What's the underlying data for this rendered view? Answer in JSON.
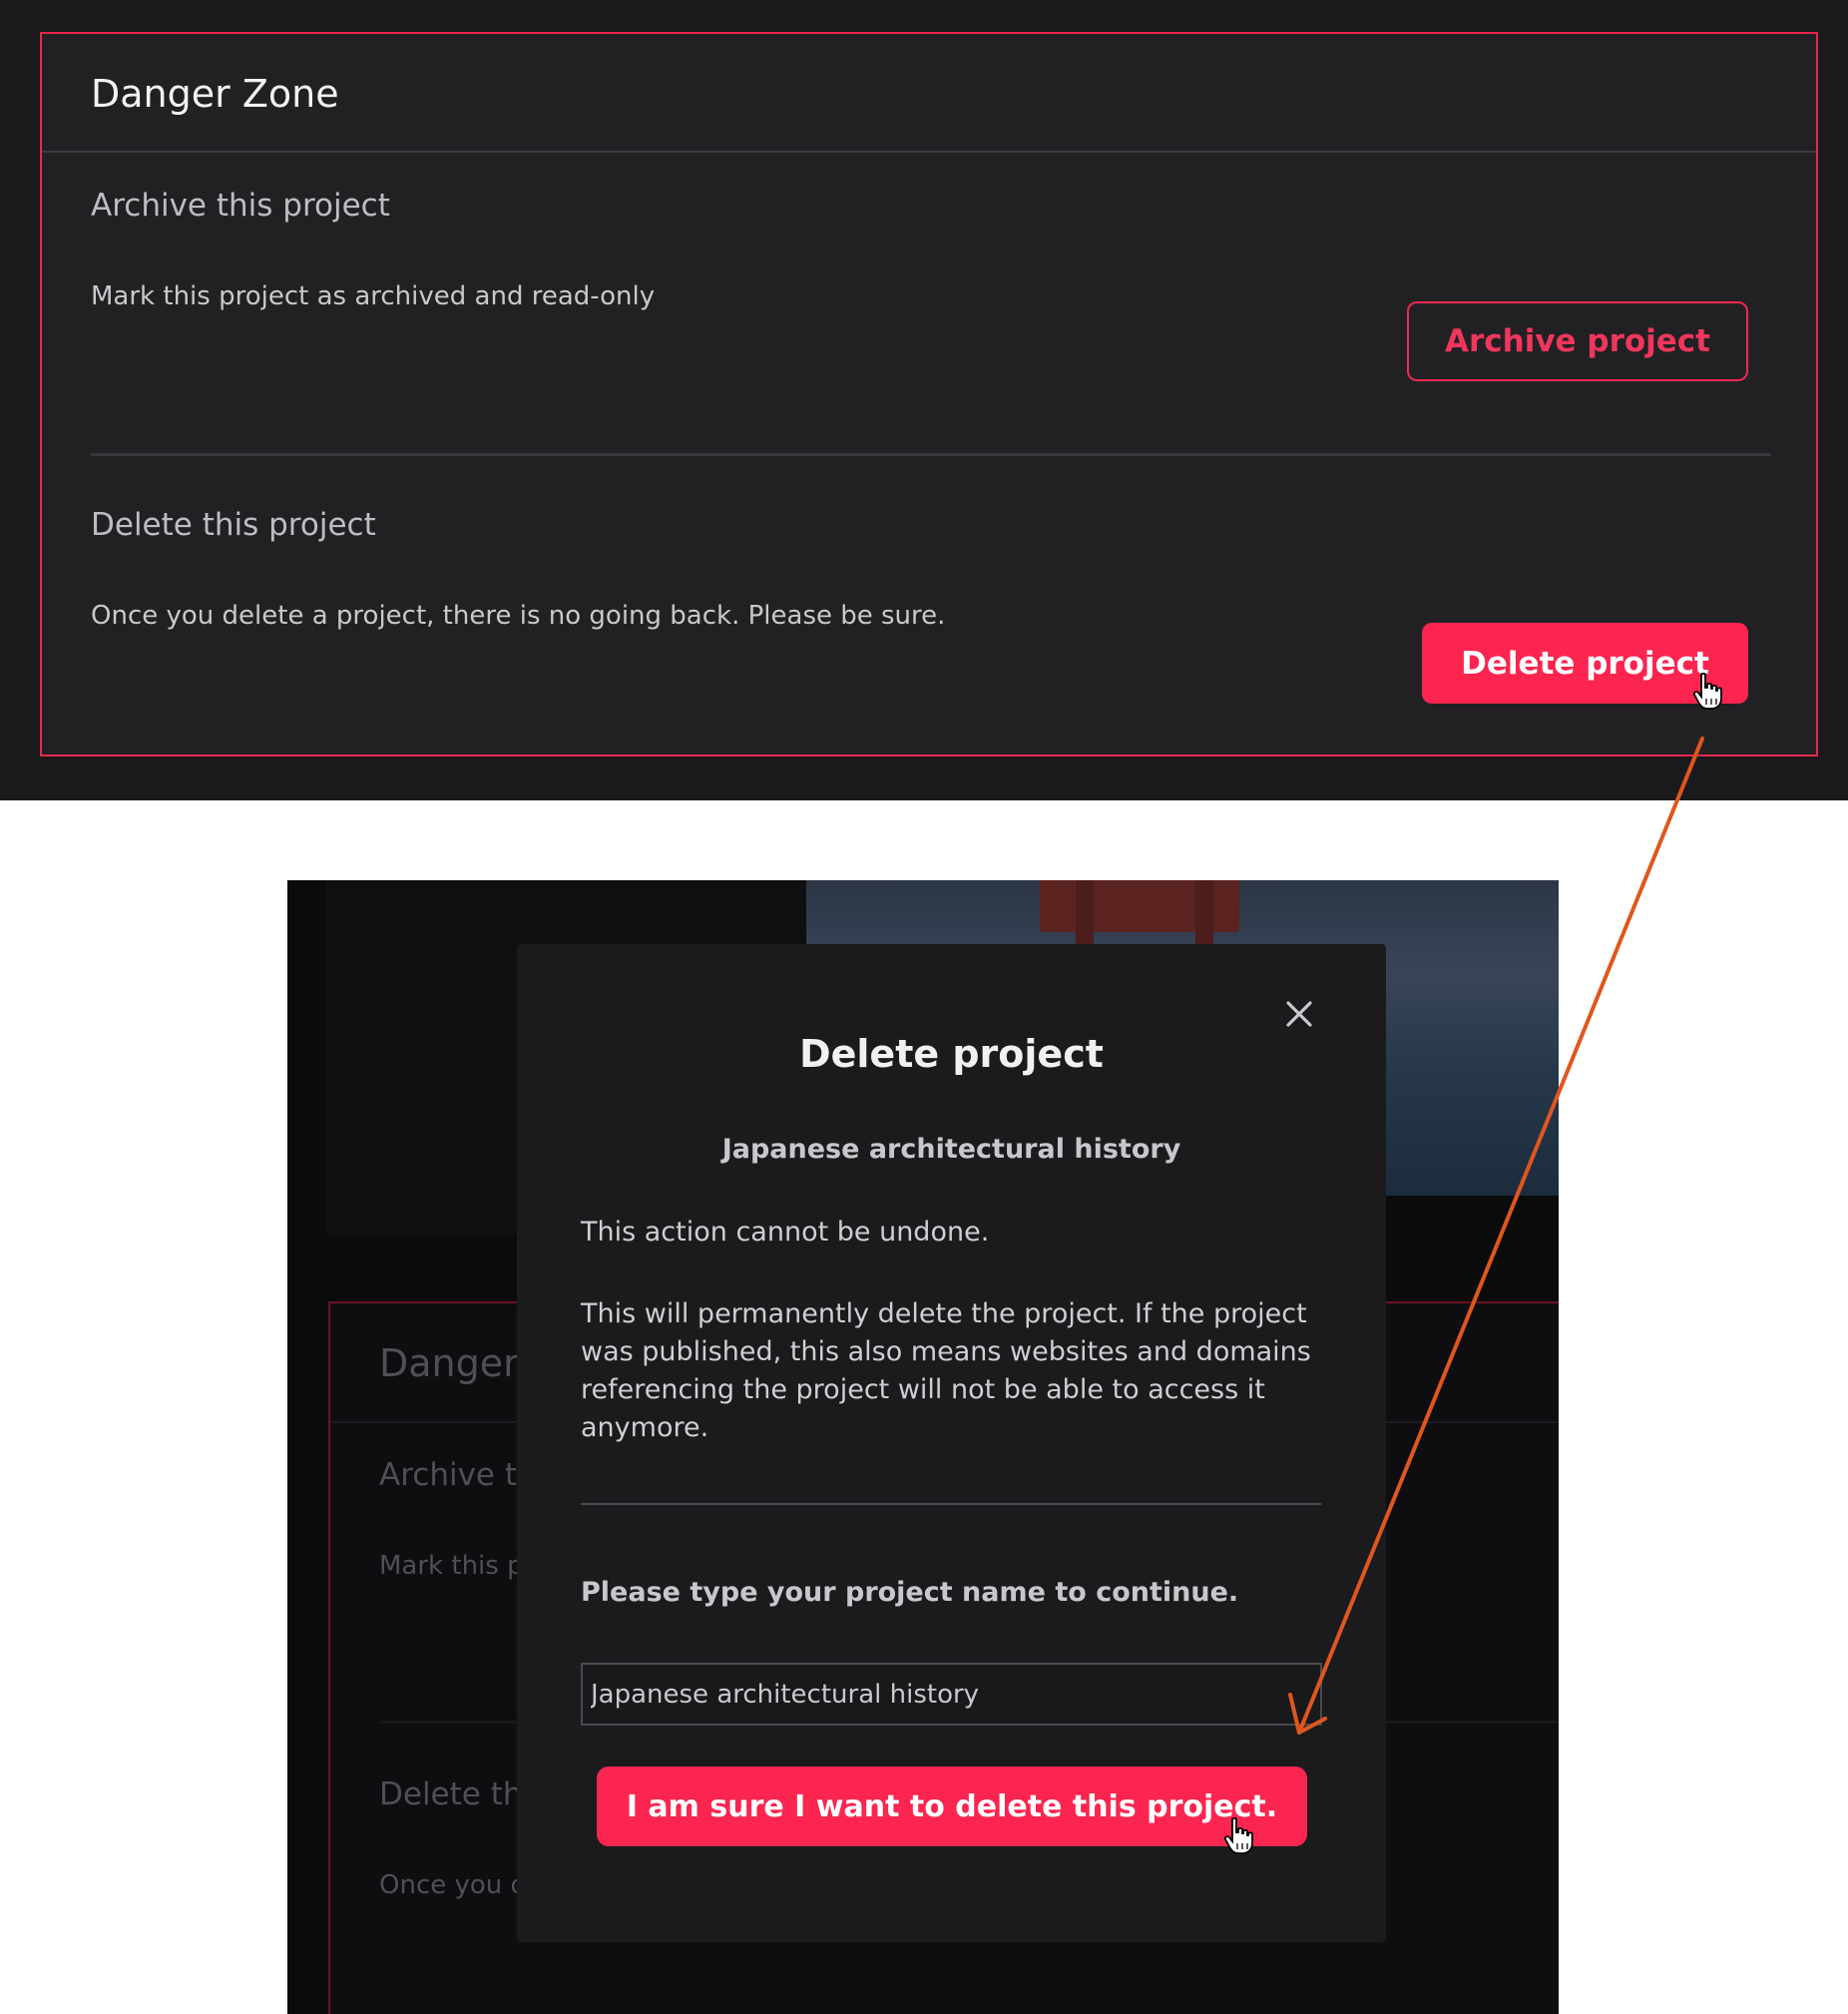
{
  "danger_zone": {
    "title": "Danger Zone",
    "archive": {
      "title": "Archive this project",
      "description": "Mark this project as archived and read-only",
      "button_label": "Archive project"
    },
    "delete": {
      "title": "Delete this project",
      "description": "Once you delete a project, there is no going back. Please be sure.",
      "button_label": "Delete project"
    }
  },
  "background_fragments": {
    "title": "Danger",
    "archive_title": "Archive th",
    "archive_desc": "Mark this p",
    "delete_title": "Delete th",
    "delete_desc": "Once you d"
  },
  "modal": {
    "title": "Delete project",
    "project_name": "Japanese architectural history",
    "warning": "This action cannot be undone.",
    "explanation": "This will permanently delete the project. If the project was published, this also means websites and domains referencing the project will not be able to access it anymore.",
    "prompt": "Please type your project name to continue.",
    "input_value": "Japanese architectural history",
    "confirm_label": "I am sure I want to delete this project.",
    "close_icon": "close-icon"
  },
  "colors": {
    "accent": "#fb2550",
    "annotation_arrow": "#e0561f"
  }
}
